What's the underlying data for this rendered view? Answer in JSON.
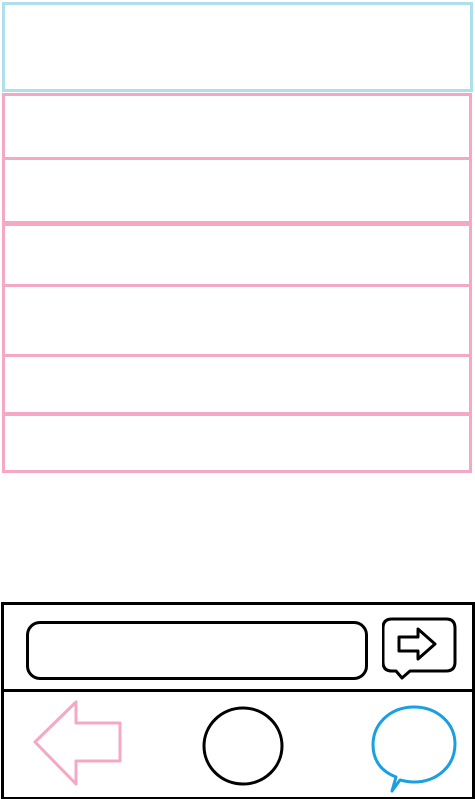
{
  "header": {
    "title": ""
  },
  "list": {
    "items": [
      {
        "label": ""
      },
      {
        "label": ""
      },
      {
        "label": ""
      },
      {
        "label": ""
      },
      {
        "label": ""
      },
      {
        "label": ""
      }
    ]
  },
  "composer": {
    "input_value": "",
    "input_placeholder": "",
    "send_icon": "send-arrow-bubble-icon"
  },
  "bottom_nav": {
    "back_icon": "back-arrow-icon",
    "home_icon": "home-circle-icon",
    "chat_icon": "chat-bubble-icon"
  },
  "colors": {
    "header_border": "#aee0ec",
    "list_border": "#f5a8c6",
    "outline": "#000000",
    "back_icon": "#f5a8c6",
    "chat_icon": "#1a9fe0"
  }
}
